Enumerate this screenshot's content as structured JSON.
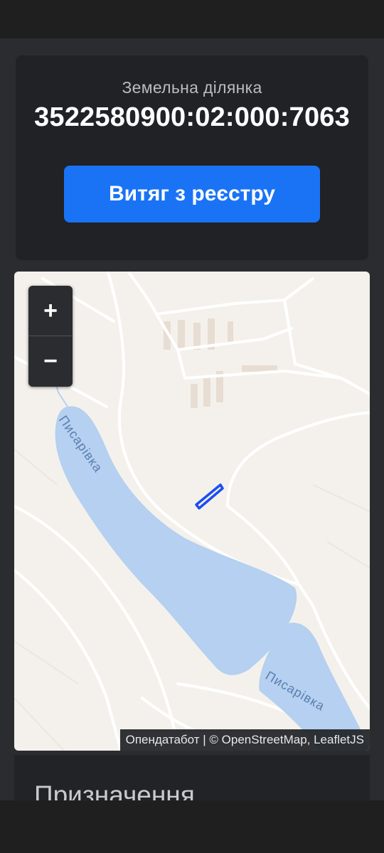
{
  "card": {
    "label": "Земельна ділянка",
    "cadastral_number": "3522580900:02:000:7063",
    "button_label": "Витяг з реєстру"
  },
  "map": {
    "zoom_in_label": "+",
    "zoom_out_label": "−",
    "river_labels": [
      "Писарівка",
      "Писарівка"
    ],
    "attribution": "Опендатабот | © OpenStreetMap, LeafletJS"
  },
  "section": {
    "title": "Призначення"
  },
  "colors": {
    "accent": "#1a73f5",
    "water": "#b5d0f0",
    "parcel_outline": "#1a4ef0"
  }
}
